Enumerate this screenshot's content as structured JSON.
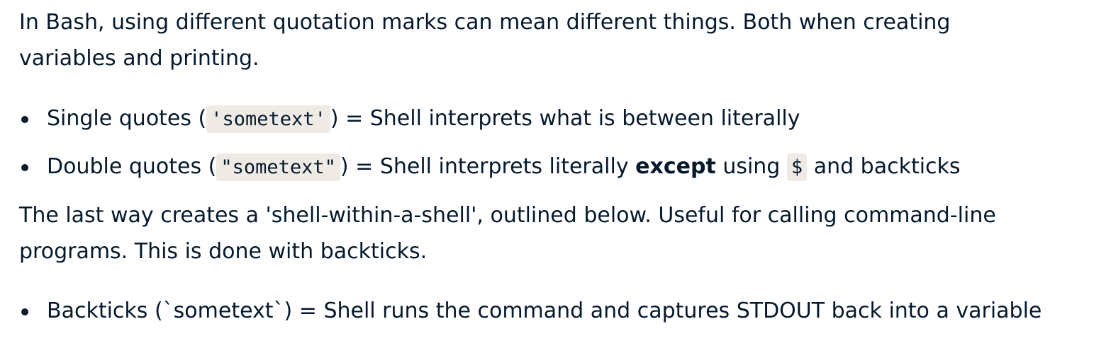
{
  "intro": {
    "line1": "In Bash, using different quotation marks can mean different things. Both when creating",
    "line2": "variables and printing."
  },
  "quote_types": [
    {
      "prefix": "Single quotes (",
      "code": "'sometext'",
      "suffix": ") = Shell interprets what is between literally"
    },
    {
      "prefix": "Double quotes (",
      "code": "\"sometext\"",
      "middle": ") = Shell interprets literally ",
      "emphasis": "except",
      "middle2": " using ",
      "code2": "$",
      "suffix": " and backticks"
    }
  ],
  "shell_within_shell": {
    "line1": "The last way creates a 'shell-within-a-shell', outlined below. Useful for calling command-line",
    "line2": "programs. This is done with backticks."
  },
  "backticks_item": {
    "text": "Backticks (`sometext`) = Shell runs the command and captures STDOUT back into a variable"
  }
}
